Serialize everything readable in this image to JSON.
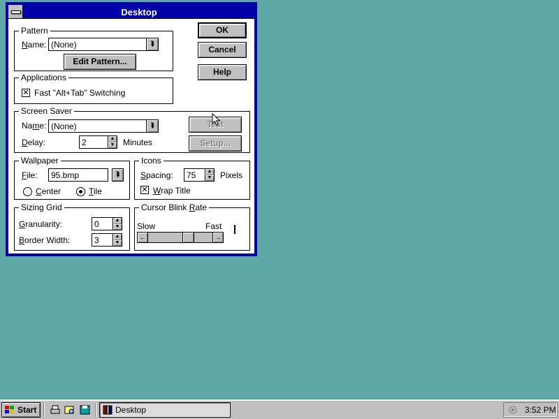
{
  "window": {
    "title": "Desktop"
  },
  "buttons": {
    "ok": "OK",
    "cancel": "Cancel",
    "help": "Help"
  },
  "pattern": {
    "legend": "Pattern",
    "name_label": "Name:",
    "name_value": "(None)",
    "edit_button": "Edit Pattern..."
  },
  "applications": {
    "legend": "Applications",
    "fast_switching_label": "Fast \"Alt+Tab\" Switching",
    "fast_switching_checked": true
  },
  "screen_saver": {
    "legend": "Screen Saver",
    "name_label": "Name:",
    "name_value": "(None)",
    "delay_label": "Delay:",
    "delay_value": "2",
    "delay_unit": "Minutes",
    "test_button": "Test",
    "setup_button": "Setup..."
  },
  "wallpaper": {
    "legend": "Wallpaper",
    "file_label": "File:",
    "file_value": "95.bmp",
    "center_label": "Center",
    "tile_label": "Tile",
    "selected": "Tile"
  },
  "icons": {
    "legend": "Icons",
    "spacing_label": "Spacing:",
    "spacing_value": "75",
    "spacing_unit": "Pixels",
    "wrap_title_label": "Wrap Title",
    "wrap_title_checked": true
  },
  "sizing_grid": {
    "legend": "Sizing Grid",
    "granularity_label": "Granularity:",
    "granularity_value": "0",
    "border_width_label": "Border Width:",
    "border_width_value": "3"
  },
  "cursor_blink": {
    "legend": "Cursor Blink Rate",
    "slow_label": "Slow",
    "fast_label": "Fast",
    "rate_fraction": 0.65
  },
  "taskbar": {
    "start_label": "Start",
    "task_label": "Desktop",
    "clock": "3:52 PM"
  },
  "colors": {
    "desktop": "#5fa8a8",
    "titlebar": "#0000a8",
    "face": "#c0c0c0"
  }
}
